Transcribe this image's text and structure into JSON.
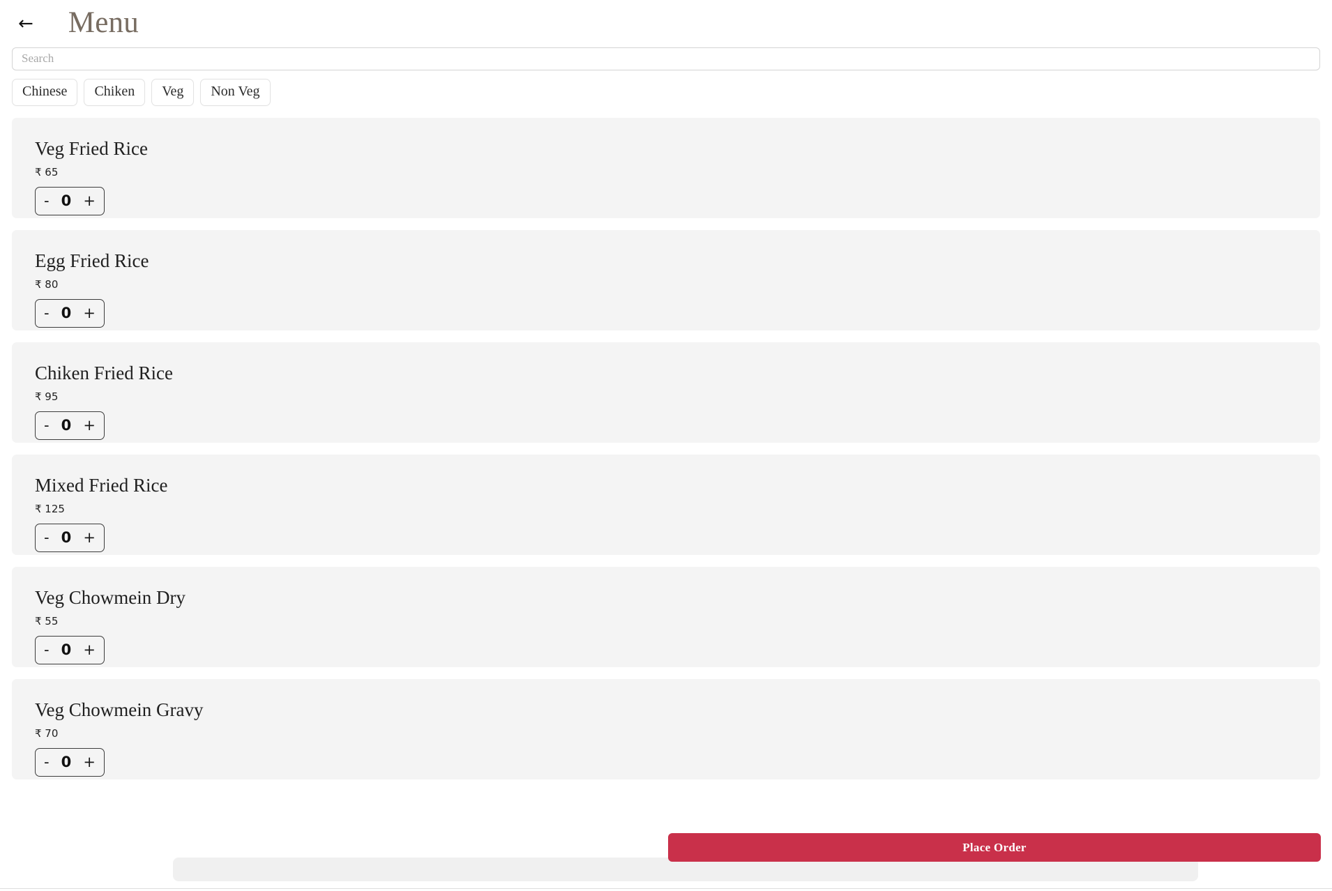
{
  "header": {
    "back_label": "←",
    "title": "Menu"
  },
  "search": {
    "placeholder": "Search",
    "value": ""
  },
  "filters": [
    {
      "label": "Chinese"
    },
    {
      "label": "Chiken"
    },
    {
      "label": "Veg"
    },
    {
      "label": "Non Veg"
    }
  ],
  "stepper": {
    "decrement_label": "-",
    "increment_label": "+"
  },
  "currency_symbol": "₹",
  "items": [
    {
      "name": "Veg Fried Rice",
      "price": "₹ 65",
      "qty": "0"
    },
    {
      "name": "Egg Fried Rice",
      "price": "₹ 80",
      "qty": "0"
    },
    {
      "name": "Chiken Fried Rice",
      "price": "₹ 95",
      "qty": "0"
    },
    {
      "name": "Mixed Fried Rice",
      "price": "₹ 125",
      "qty": "0"
    },
    {
      "name": "Veg Chowmein Dry",
      "price": "₹ 55",
      "qty": "0"
    },
    {
      "name": "Veg Chowmein Gravy",
      "price": "₹ 70",
      "qty": "0"
    }
  ],
  "footer": {
    "place_order_label": "Place Order"
  },
  "colors": {
    "accent": "#c9304a",
    "title": "#776c61",
    "card_bg": "#f4f4f4",
    "page_bg": "#ffffff"
  }
}
